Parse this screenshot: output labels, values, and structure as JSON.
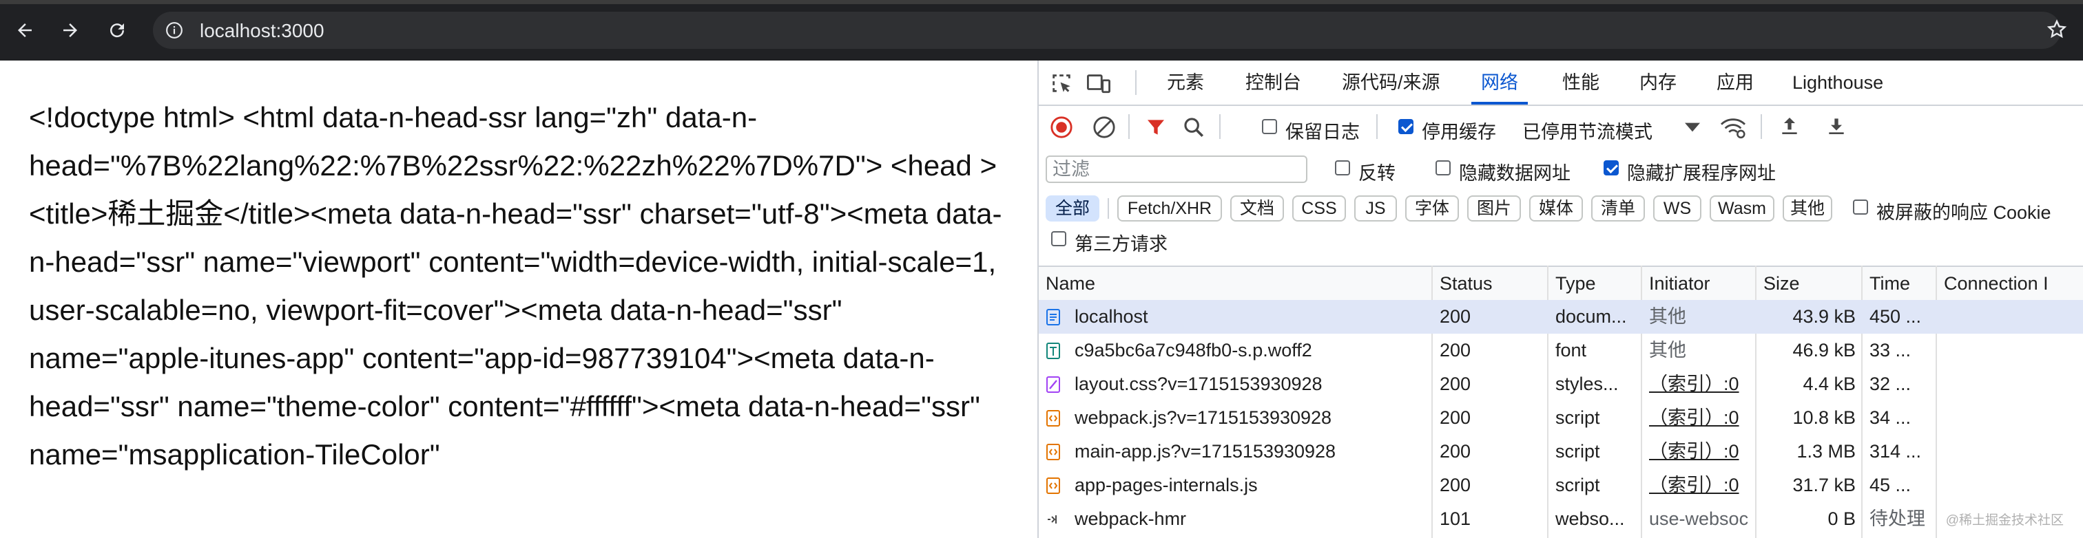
{
  "browser": {
    "url": "localhost:3000"
  },
  "page": {
    "source_text": "<!doctype html> <html data-n-head-ssr lang=\"zh\" data-n-head=\"%7B%22lang%22:%7B%22ssr%22:%22zh%22%7D%7D\"> <head > <title>稀土掘金</title><meta data-n-head=\"ssr\" charset=\"utf-8\"><meta data-n-head=\"ssr\" name=\"viewport\" content=\"width=device-width, initial-scale=1, user-scalable=no, viewport-fit=cover\"><meta data-n-head=\"ssr\" name=\"apple-itunes-app\" content=\"app-id=987739104\"><meta data-n-head=\"ssr\" name=\"theme-color\" content=\"#ffffff\"><meta data-n-head=\"ssr\" name=\"msapplication-TileColor\""
  },
  "devtools": {
    "tabs": [
      "元素",
      "控制台",
      "源代码/来源",
      "网络",
      "性能",
      "内存",
      "应用",
      "Lighthouse"
    ],
    "active_tab": "网络",
    "toolbar": {
      "preserve_log": "保留日志",
      "disable_cache": "停用缓存",
      "throttle": "已停用节流模式"
    },
    "filter": {
      "placeholder": "过滤",
      "invert": "反转",
      "hide_data_urls": "隐藏数据网址",
      "hide_ext_urls": "隐藏扩展程序网址"
    },
    "types": [
      "全部",
      "Fetch/XHR",
      "文档",
      "CSS",
      "JS",
      "字体",
      "图片",
      "媒体",
      "清单",
      "WS",
      "Wasm",
      "其他"
    ],
    "blocked_cookies": "被屏蔽的响应 Cookie",
    "third_party": "第三方请求",
    "columns": [
      "Name",
      "Status",
      "Type",
      "Initiator",
      "Size",
      "Time",
      "Connection I"
    ],
    "rows": [
      {
        "icon": "document-icon",
        "name": "localhost",
        "status": "200",
        "type": "docum...",
        "initiator": "其他",
        "initiator_link": false,
        "size": "43.9 kB",
        "time": "450 ..."
      },
      {
        "icon": "font-file-icon",
        "name": "c9a5bc6a7c948fb0-s.p.woff2",
        "status": "200",
        "type": "font",
        "initiator": "其他",
        "initiator_link": false,
        "size": "46.9 kB",
        "time": "33 ..."
      },
      {
        "icon": "stylesheet-icon",
        "name": "layout.css?v=1715153930928",
        "status": "200",
        "type": "styles...",
        "initiator": "（索引）:0",
        "initiator_link": true,
        "size": "4.4 kB",
        "time": "32 ..."
      },
      {
        "icon": "script-icon",
        "name": "webpack.js?v=1715153930928",
        "status": "200",
        "type": "script",
        "initiator": "（索引）:0",
        "initiator_link": true,
        "size": "10.8 kB",
        "time": "34 ..."
      },
      {
        "icon": "script-icon",
        "name": "main-app.js?v=1715153930928",
        "status": "200",
        "type": "script",
        "initiator": "（索引）:0",
        "initiator_link": true,
        "size": "1.3 MB",
        "time": "314 ..."
      },
      {
        "icon": "script-icon",
        "name": "app-pages-internals.js",
        "status": "200",
        "type": "script",
        "initiator": "（索引）:0",
        "initiator_link": true,
        "size": "31.7 kB",
        "time": "45 ..."
      },
      {
        "icon": "websocket-icon",
        "name": "webpack-hmr",
        "status": "101",
        "type": "webso...",
        "initiator": "use-websoc",
        "initiator_link": false,
        "size": "0 B",
        "time": "待处理"
      }
    ],
    "colors": {
      "accent": "#0b57d0",
      "record": "#d93025",
      "filter": "#d93025"
    }
  },
  "watermark": "@稀土掘金技术社区"
}
